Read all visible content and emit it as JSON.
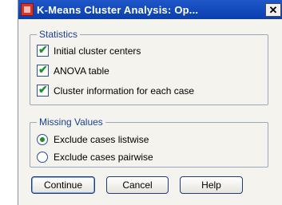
{
  "window": {
    "title": "K-Means Cluster Analysis: Op...",
    "close_label": "✕"
  },
  "statistics": {
    "group_title": "Statistics",
    "options": [
      {
        "label": "Initial cluster centers",
        "checked": true
      },
      {
        "label": "ANOVA table",
        "checked": true
      },
      {
        "label": "Cluster information for each case",
        "checked": true
      }
    ]
  },
  "missing_values": {
    "group_title": "Missing Values",
    "options": [
      {
        "label": "Exclude cases listwise",
        "selected": true
      },
      {
        "label": "Exclude cases pairwise",
        "selected": false
      }
    ]
  },
  "buttons": {
    "continue": "Continue",
    "cancel": "Cancel",
    "help": "Help"
  },
  "check_mark": "✔"
}
